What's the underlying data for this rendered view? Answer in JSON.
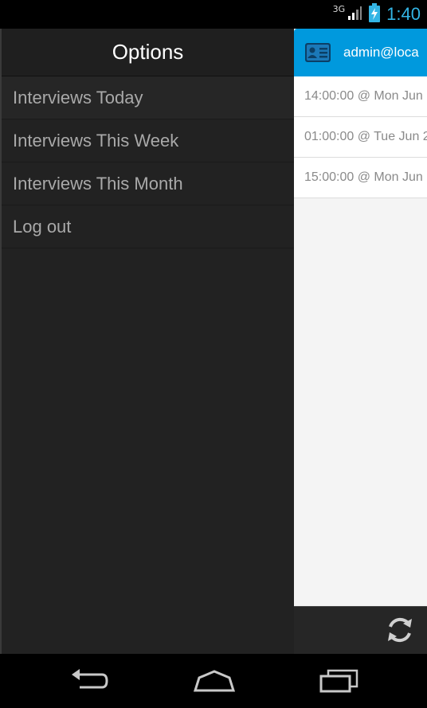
{
  "status_bar": {
    "network": "3G",
    "time": "1:40",
    "icons": [
      "signal-icon",
      "battery-charging-icon"
    ]
  },
  "drawer": {
    "title": "Options",
    "items": [
      {
        "label": "Interviews Today"
      },
      {
        "label": "Interviews This Week"
      },
      {
        "label": "Interviews This Month"
      },
      {
        "label": "Log out"
      }
    ]
  },
  "app": {
    "header_icon": "contact-card-icon",
    "user": "admin@loca",
    "interviews": [
      {
        "label": "14:00:00 @ Mon Jun"
      },
      {
        "label": "01:00:00 @ Tue Jun 2"
      },
      {
        "label": "15:00:00 @ Mon Jun"
      }
    ],
    "bottom_icon": "refresh-icon"
  },
  "nav_bar": {
    "icons": [
      "back-icon",
      "home-icon",
      "recent-apps-icon"
    ]
  },
  "colors": {
    "accent": "#33b5e5",
    "header_blue": "#0099dd",
    "drawer_bg": "#222222"
  }
}
